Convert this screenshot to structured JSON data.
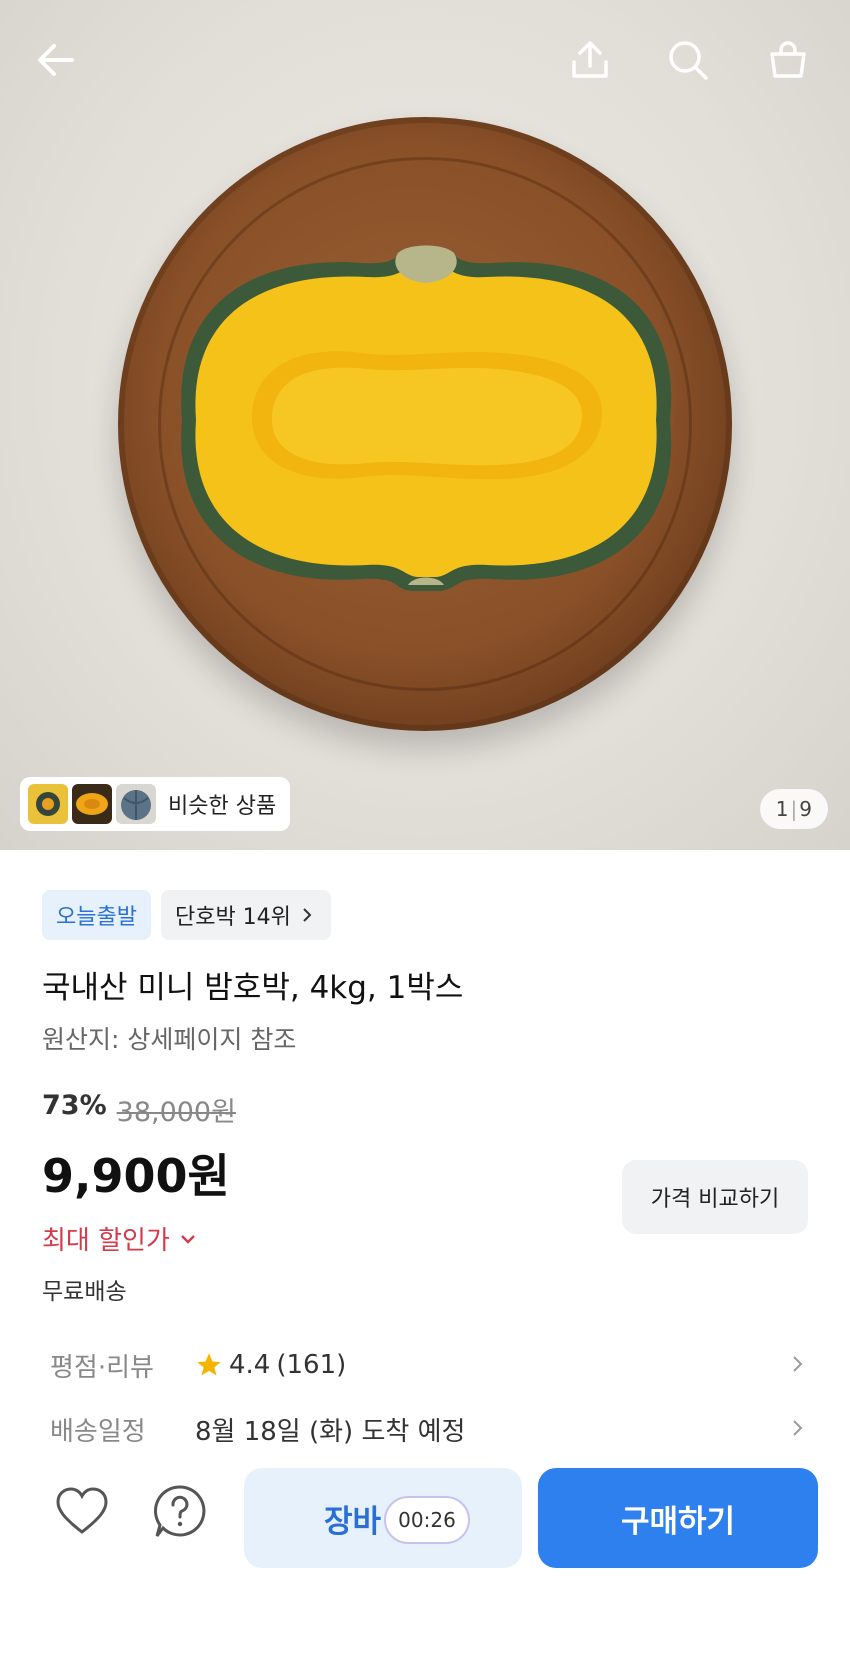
{
  "header": {
    "back_icon": "arrow-left-icon",
    "share_icon": "share-icon",
    "search_icon": "search-icon",
    "cart_icon": "shopping-bag-icon"
  },
  "gallery": {
    "similar_label": "비슷한 상품",
    "current": "1",
    "total": "9"
  },
  "badges": {
    "today_shipping": "오늘출발",
    "rank": "단호박 14위"
  },
  "product": {
    "title": "국내산 미니 밤호박, 4kg, 1박스",
    "origin": "원산지: 상세페이지 참조",
    "discount": "73%",
    "original_price": "38,000원",
    "price": "9,900원",
    "max_discount": "최대 할인가",
    "shipping": "무료배송",
    "compare_label": "가격 비교하기"
  },
  "rating_row": {
    "label": "평점·리뷰",
    "rating": "4.4",
    "count": "(161)"
  },
  "delivery_row": {
    "label": "배송일정",
    "value": "8월 18일 (화) 도착 예정"
  },
  "bottom_bar": {
    "cart_label": "장바",
    "timer": "00:26",
    "buy_label": "구매하기"
  },
  "colors": {
    "accent": "#2d80ee",
    "discount_red": "#d23b4b",
    "badge_blue_bg": "#e7f1fc"
  }
}
